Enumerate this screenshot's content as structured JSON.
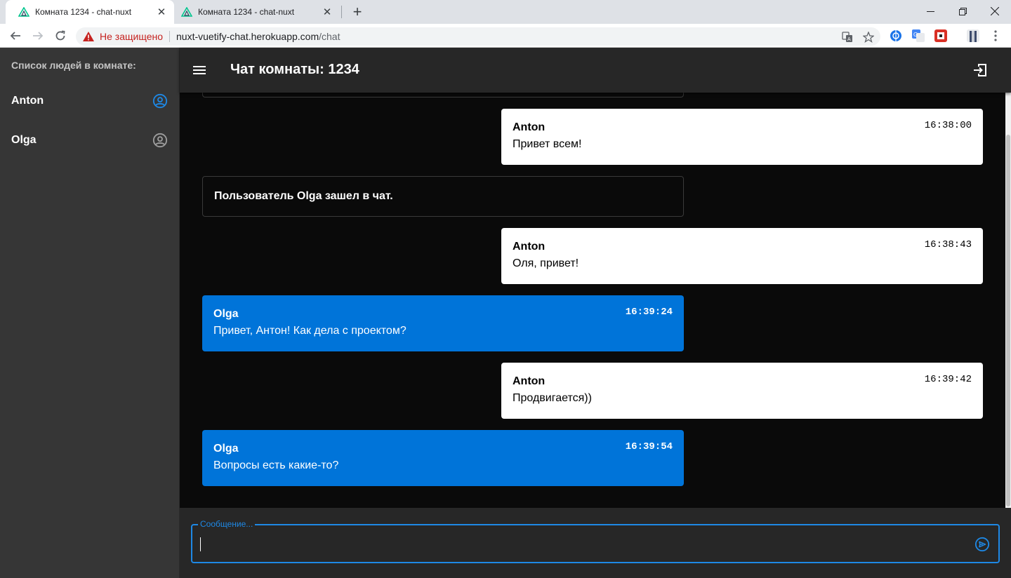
{
  "browser": {
    "tabs": [
      {
        "title": "Комната 1234 - chat-nuxt",
        "active": true
      },
      {
        "title": "Комната 1234 - chat-nuxt",
        "active": false
      }
    ],
    "security_label": "Не защищено",
    "url_host": "nuxt-vuetify-chat.herokuapp.com",
    "url_path": "/chat"
  },
  "sidebar": {
    "title": "Список людей в комнате:",
    "users": [
      {
        "name": "Anton",
        "icon": "account-circle-icon",
        "color": "#1e88e5"
      },
      {
        "name": "Olga",
        "icon": "account-circle-icon",
        "color": "#9e9e9e"
      }
    ]
  },
  "appbar": {
    "title": "Чат комнаты: 1234"
  },
  "messages": [
    {
      "type": "own",
      "author": "Anton",
      "text": "Привет всем!",
      "time": "16:38:00"
    },
    {
      "type": "system",
      "text": "Пользователь Olga зашел в чат."
    },
    {
      "type": "own",
      "author": "Anton",
      "text": "Оля, привет!",
      "time": "16:38:43"
    },
    {
      "type": "other",
      "author": "Olga",
      "text": "Привет, Антон! Как дела с проектом?",
      "time": "16:39:24"
    },
    {
      "type": "own",
      "author": "Anton",
      "text": "Продвигается))",
      "time": "16:39:42"
    },
    {
      "type": "other",
      "author": "Olga",
      "text": "Вопросы есть какие-то?",
      "time": "16:39:54"
    }
  ],
  "composer": {
    "label": "Сообщение...",
    "value": ""
  },
  "colors": {
    "accent": "#1e88e5",
    "other_message": "#0074d9",
    "sidebar_bg": "#363636",
    "appbar_bg": "#272727",
    "chat_bg": "#0a0a0a"
  }
}
